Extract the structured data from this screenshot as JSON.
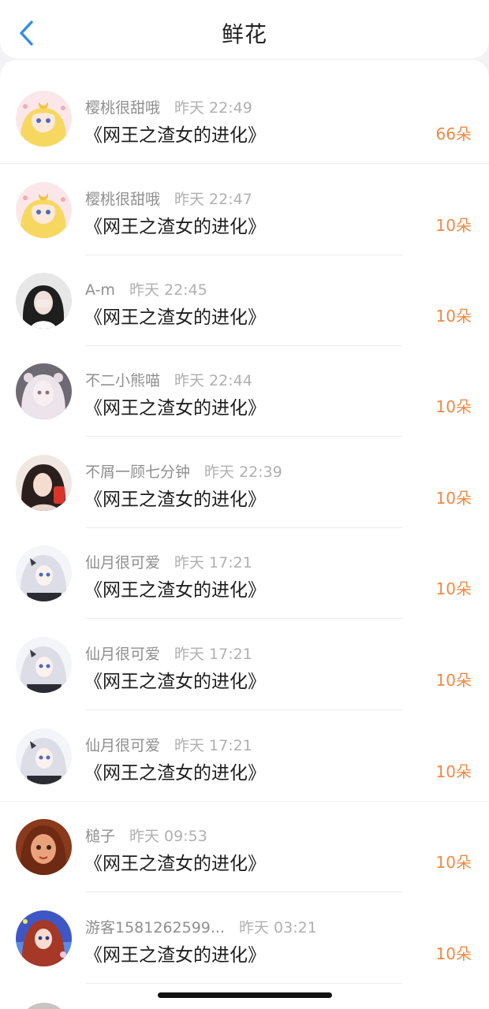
{
  "header": {
    "title": "鲜花",
    "back_icon": "chevron-left-icon",
    "accent": "#2f8fe8"
  },
  "count_color": "#ee8a45",
  "items": [
    {
      "user": "樱桃很甜哦",
      "time": "昨天 22:49",
      "book": "《网王之渣女的进化》",
      "count": "66朵",
      "avatar": "anime-moon-girl"
    },
    {
      "user": "樱桃很甜哦",
      "time": "昨天 22:47",
      "book": "《网王之渣女的进化》",
      "count": "10朵",
      "avatar": "anime-moon-girl"
    },
    {
      "user": "A-m",
      "time": "昨天 22:45",
      "book": "《网王之渣女的进化》",
      "count": "10朵",
      "avatar": "dark-hair-girl"
    },
    {
      "user": "不二小熊喵",
      "time": "昨天 22:44",
      "book": "《网王之渣女的进化》",
      "count": "10朵",
      "avatar": "pale-doll"
    },
    {
      "user": "不屑一顾七分钟",
      "time": "昨天 22:39",
      "book": "《网王之渣女的进化》",
      "count": "10朵",
      "avatar": "girl-red-drink"
    },
    {
      "user": "仙月很可爱",
      "time": "昨天 17:21",
      "book": "《网王之渣女的进化》",
      "count": "10朵",
      "avatar": "silver-hair-anime"
    },
    {
      "user": "仙月很可爱",
      "time": "昨天 17:21",
      "book": "《网王之渣女的进化》",
      "count": "10朵",
      "avatar": "silver-hair-anime"
    },
    {
      "user": "仙月很可爱",
      "time": "昨天 17:21",
      "book": "《网王之渣女的进化》",
      "count": "10朵",
      "avatar": "silver-hair-anime"
    },
    {
      "user": "槌子",
      "time": "昨天 09:53",
      "book": "《网王之渣女的进化》",
      "count": "10朵",
      "avatar": "painted-portrait"
    },
    {
      "user": "游客1581262599...",
      "time": "昨天 03:21",
      "book": "《网王之渣女的进化》",
      "count": "10朵",
      "avatar": "anime-blue-sky"
    }
  ]
}
